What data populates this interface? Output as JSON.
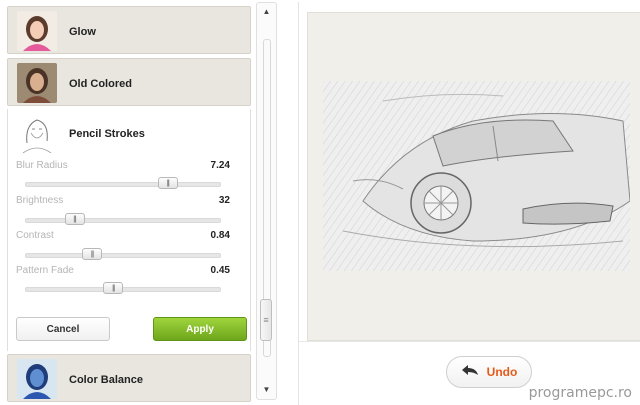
{
  "effects": {
    "top_items": [
      {
        "label": "Glow"
      },
      {
        "label": "Old Colored"
      }
    ],
    "expanded": {
      "label": "Pencil Strokes",
      "params": [
        {
          "label": "Blur Radius",
          "value": "7.24",
          "fraction": 0.73
        },
        {
          "label": "Brightness",
          "value": "32",
          "fraction": 0.25
        },
        {
          "label": "Contrast",
          "value": "0.84",
          "fraction": 0.34
        },
        {
          "label": "Pattern Fade",
          "value": "0.45",
          "fraction": 0.45
        }
      ],
      "cancel_label": "Cancel",
      "apply_label": "Apply"
    },
    "bottom_items": [
      {
        "label": "Color Balance"
      }
    ]
  },
  "scrollbar": {
    "up_arrow": "▲",
    "down_arrow": "▼"
  },
  "preview": {
    "undo_label": "Undo"
  },
  "watermark": "programepc.ro",
  "colors": {
    "apply": "#7cb526",
    "undo": "#e45a1a",
    "panel": "#e9e6df"
  },
  "icons": [
    "glow-thumbnail",
    "old-colored-thumbnail",
    "pencil-strokes-thumbnail",
    "color-balance-thumbnail",
    "undo-arrow-icon"
  ]
}
